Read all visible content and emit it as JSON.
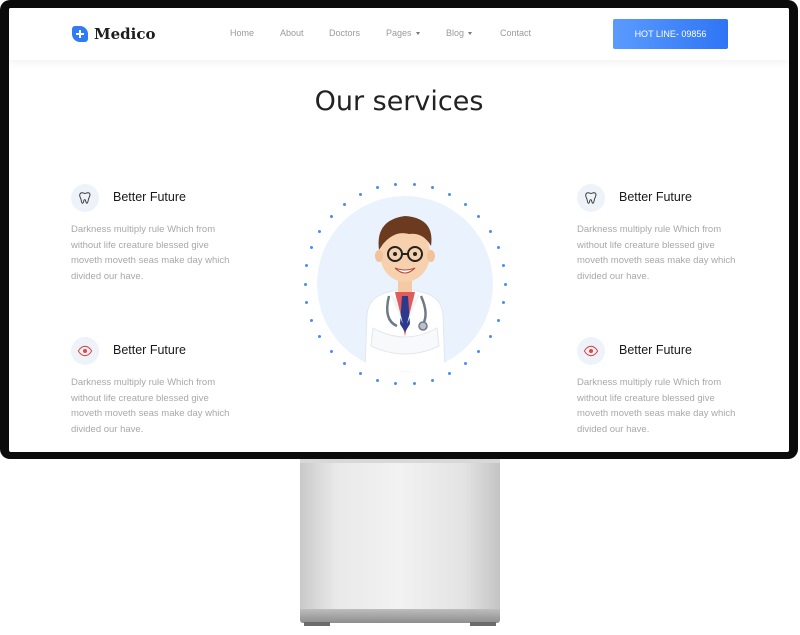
{
  "header": {
    "logo_text": "Medico",
    "nav": [
      {
        "label": "Home",
        "dropdown": false
      },
      {
        "label": "About",
        "dropdown": false
      },
      {
        "label": "Doctors",
        "dropdown": false
      },
      {
        "label": "Pages",
        "dropdown": true
      },
      {
        "label": "Blog",
        "dropdown": true
      },
      {
        "label": "Contact",
        "dropdown": false
      }
    ],
    "hotline_label": "HOT LINE- 09856"
  },
  "main": {
    "title": "Our services",
    "services": [
      {
        "icon": "tooth-icon",
        "title": "Better Future",
        "text": "Darkness multiply rule Which from without life creature blessed give moveth moveth seas make day which divided our have."
      },
      {
        "icon": "tooth-icon",
        "title": "Better Future",
        "text": "Darkness multiply rule Which from without life creature blessed give moveth moveth seas make day which divided our have."
      },
      {
        "icon": "eye-icon",
        "title": "Better Future",
        "text": "Darkness multiply rule Which from without life creature blessed give moveth moveth seas make day which divided our have."
      },
      {
        "icon": "eye-icon",
        "title": "Better Future",
        "text": "Darkness multiply rule Which from without life creature blessed give moveth moveth seas make day which divided our have."
      }
    ]
  },
  "colors": {
    "accent": "#2f7cf6",
    "icon_bg": "#eef3fa",
    "doctor_bg": "#eaf3fd"
  }
}
